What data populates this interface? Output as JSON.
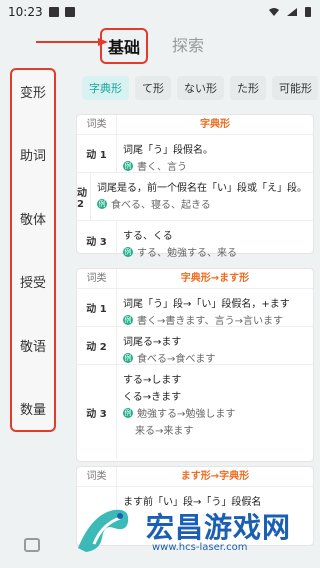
{
  "status": {
    "time": "10:23",
    "right_icons": [
      "wifi-icon",
      "signal-icon",
      "battery-icon"
    ]
  },
  "tabs": [
    {
      "label": "基础",
      "active": true
    },
    {
      "label": "探索",
      "active": false
    }
  ],
  "sidebar": {
    "items": [
      "变形",
      "助词",
      "敬体",
      "授受",
      "敬语",
      "数量"
    ]
  },
  "chips": {
    "items": [
      "字典形",
      "て形",
      "ない形",
      "た形",
      "可能形"
    ]
  },
  "tables": [
    {
      "header": {
        "k": "词类",
        "v": "字典形"
      },
      "rows": [
        {
          "k": "动 1",
          "lines": [
            "词尾「う」段假名。"
          ],
          "examples": [
            "書く、言う"
          ]
        },
        {
          "k": "动 2",
          "lines": [
            "词尾是る，前一个假名在「い」段或「え」段。"
          ],
          "examples": [
            "食べる、寝る、起きる"
          ]
        },
        {
          "k": "动 3",
          "lines": [
            "する、くる"
          ],
          "examples": [
            "する、勉強する、来る"
          ]
        }
      ]
    },
    {
      "header": {
        "k": "词类",
        "v": "字典形→ます形"
      },
      "rows": [
        {
          "k": "动 1",
          "lines": [
            "词尾「う」段→「い」段假名，+ます"
          ],
          "examples": [
            "書く→書きます、言う→言います"
          ]
        },
        {
          "k": "动 2",
          "lines": [
            "词尾る→ます"
          ],
          "examples": [
            "食べる→食べます"
          ]
        },
        {
          "k": "动 3",
          "lines": [
            "する→します",
            "くる→きます"
          ],
          "examples": [
            "勉強する→勉強します"
          ],
          "extra": "来る→来ます"
        }
      ]
    },
    {
      "header": {
        "k": "词类",
        "v": "ます形→字典形"
      },
      "rows": [
        {
          "k": "",
          "lines": [
            "ます前「い」段→「う」段假名"
          ],
          "examples": []
        }
      ]
    }
  ],
  "watermark": {
    "title": "宏昌游戏网",
    "url": "www.hcs-laser.com"
  }
}
